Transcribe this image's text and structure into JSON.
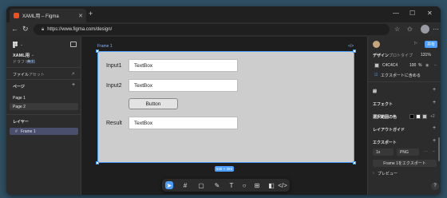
{
  "browser": {
    "tab_title": "XAML用 – Figma",
    "url": "https://www.figma.com/design/",
    "new_tab": "+",
    "close": "✕",
    "minimize": "—",
    "maximize": "☐",
    "win_close": "✕"
  },
  "left_panel": {
    "file_name": "XAML用",
    "file_sub": "ドラフト",
    "file_badge": "無料",
    "tabs": [
      "ファイル",
      "アセット"
    ],
    "pages_heading": "ページ",
    "pages": [
      "Page 1",
      "Page 2"
    ],
    "layers_heading": "レイヤー",
    "layers": [
      "Frame 1"
    ]
  },
  "canvas": {
    "frame_label": "Frame 1",
    "frame_code": "</>",
    "rows": [
      {
        "label": "Input1",
        "value": "TextBox"
      },
      {
        "label": "Input2",
        "value": "TextBox"
      },
      {
        "label": "Result",
        "value": "TextBox"
      }
    ],
    "button_label": "Button",
    "size_badge": "640 × 360"
  },
  "right_panel": {
    "share": "共有",
    "tabs": [
      "デザイン",
      "プロトタイプ"
    ],
    "zoom": "131%",
    "fill_hex": "C4C4C4",
    "fill_opacity": "100",
    "fill_opacity_unit": "%",
    "export_checkbox": "エクスポートに含める",
    "sections": [
      "線",
      "エフェクト",
      "選択範囲の色",
      "レイアウトガイド",
      "エクスポート"
    ],
    "export_scale": "1x",
    "export_format": "PNG",
    "export_button": "Frame 1をエクスポート",
    "preview": "プレビュー",
    "help": "?",
    "selection_more": "+2"
  },
  "colors": {
    "accent": "#4c9ffe",
    "frame_fill": "#C4C4C4"
  }
}
